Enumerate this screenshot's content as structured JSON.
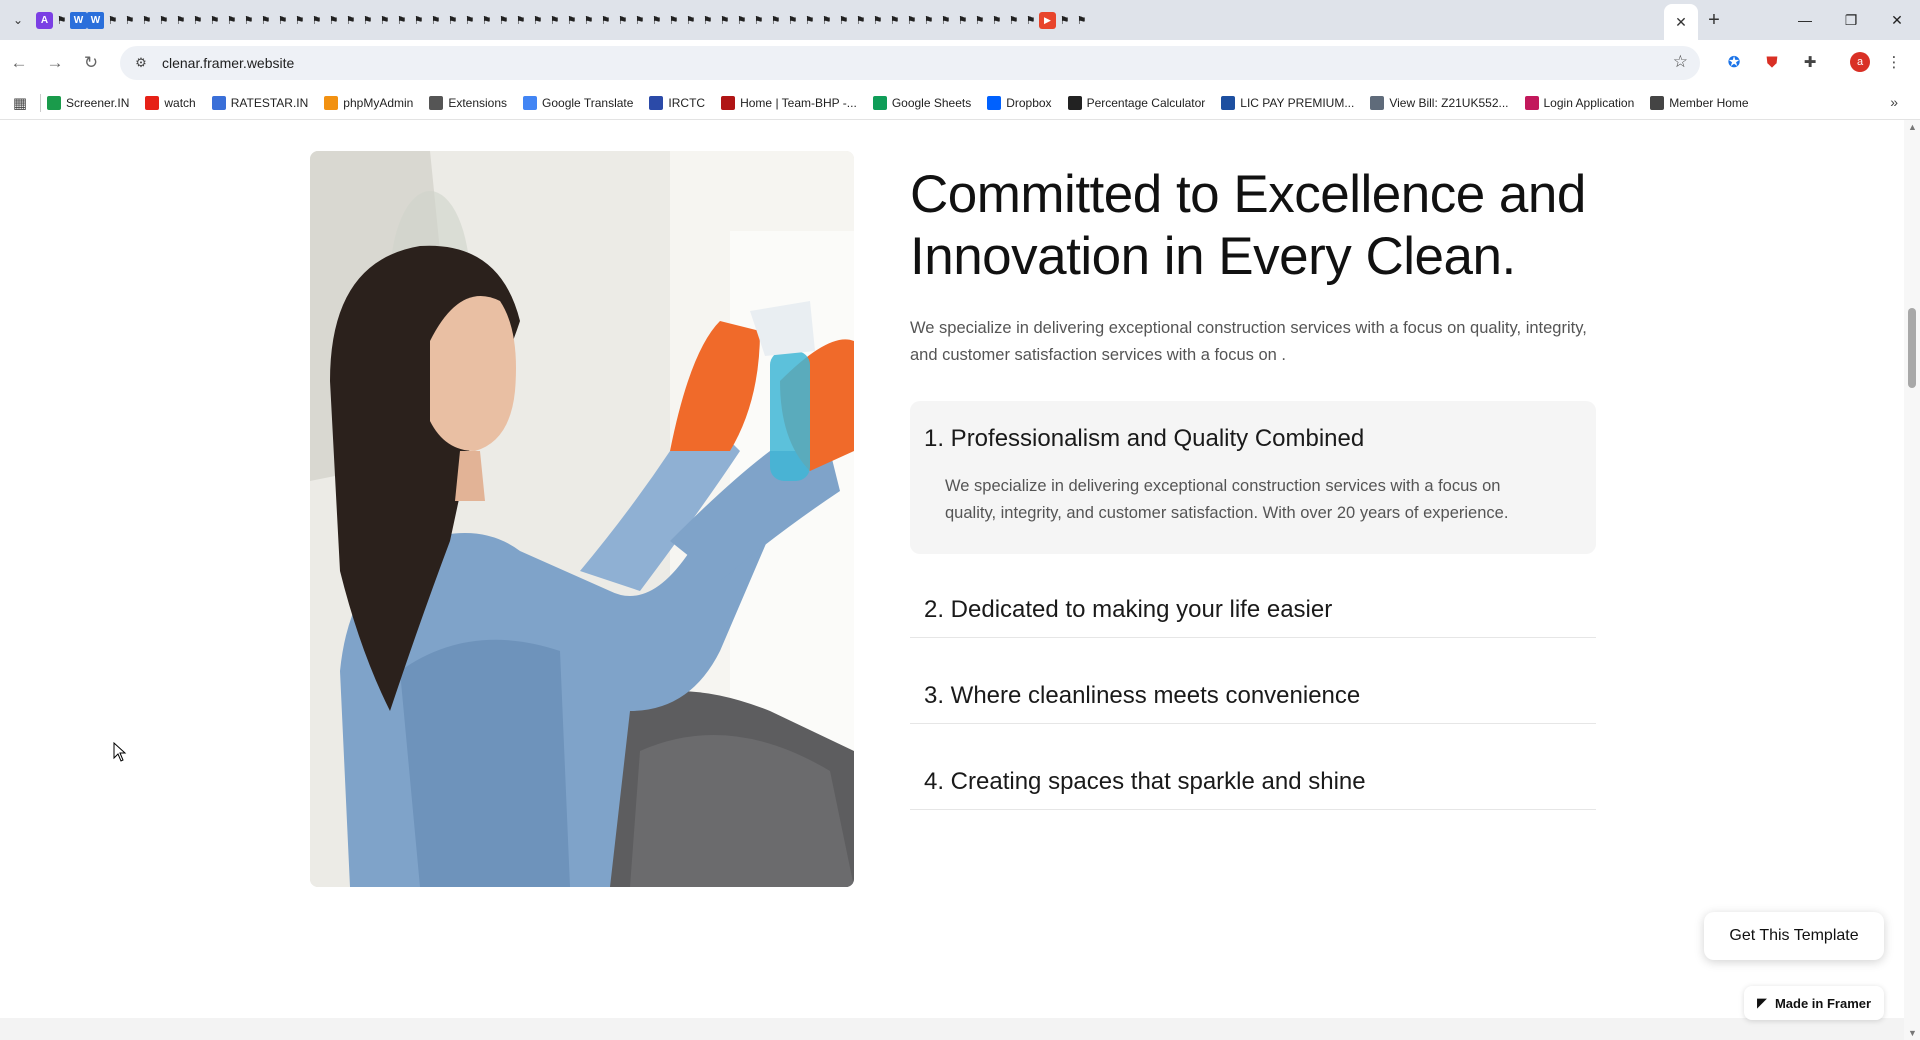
{
  "browser": {
    "tab_close": "✕",
    "new_tab": "+",
    "window": {
      "minimize": "—",
      "maximize": "❐",
      "close": "✕"
    },
    "url": "clenar.framer.website",
    "bookmarks": [
      {
        "label": "Screener.IN",
        "color": "#1a9b4b"
      },
      {
        "label": "watch",
        "color": "#e62117"
      },
      {
        "label": "RATESTAR.IN",
        "color": "#3a6fd8"
      },
      {
        "label": "phpMyAdmin",
        "color": "#f29111"
      },
      {
        "label": "Extensions",
        "color": "#555555"
      },
      {
        "label": "Google Translate",
        "color": "#4285f4"
      },
      {
        "label": "IRCTC",
        "color": "#2b4aa8"
      },
      {
        "label": "Home | Team-BHP -...",
        "color": "#b01515"
      },
      {
        "label": "Google Sheets",
        "color": "#0f9d58"
      },
      {
        "label": "Dropbox",
        "color": "#0061fe"
      },
      {
        "label": "Percentage Calculator",
        "color": "#222222"
      },
      {
        "label": "LIC PAY PREMIUM...",
        "color": "#1d4fa0"
      },
      {
        "label": "View Bill: Z21UK552...",
        "color": "#5f6b7a"
      },
      {
        "label": "Login Application",
        "color": "#c2185b"
      },
      {
        "label": "Member Home",
        "color": "#444444"
      }
    ]
  },
  "page": {
    "heading": "Committed to Excellence and Innovation in Every Clean.",
    "intro": "We specialize in delivering exceptional construction services with a focus on quality, integrity, and customer satisfaction  services with a focus on .",
    "accordion": [
      {
        "title": "1. Professionalism and Quality Combined",
        "body": "We specialize in delivering exceptional construction services with a focus on quality, integrity, and customer satisfaction. With over 20 years of experience."
      },
      {
        "title": "2. Dedicated to making your life easier"
      },
      {
        "title": "3. Where cleanliness meets convenience"
      },
      {
        "title": "4. Creating spaces that sparkle and shine"
      }
    ],
    "get_template": "Get This Template",
    "made_in_framer": "Made in Framer"
  }
}
